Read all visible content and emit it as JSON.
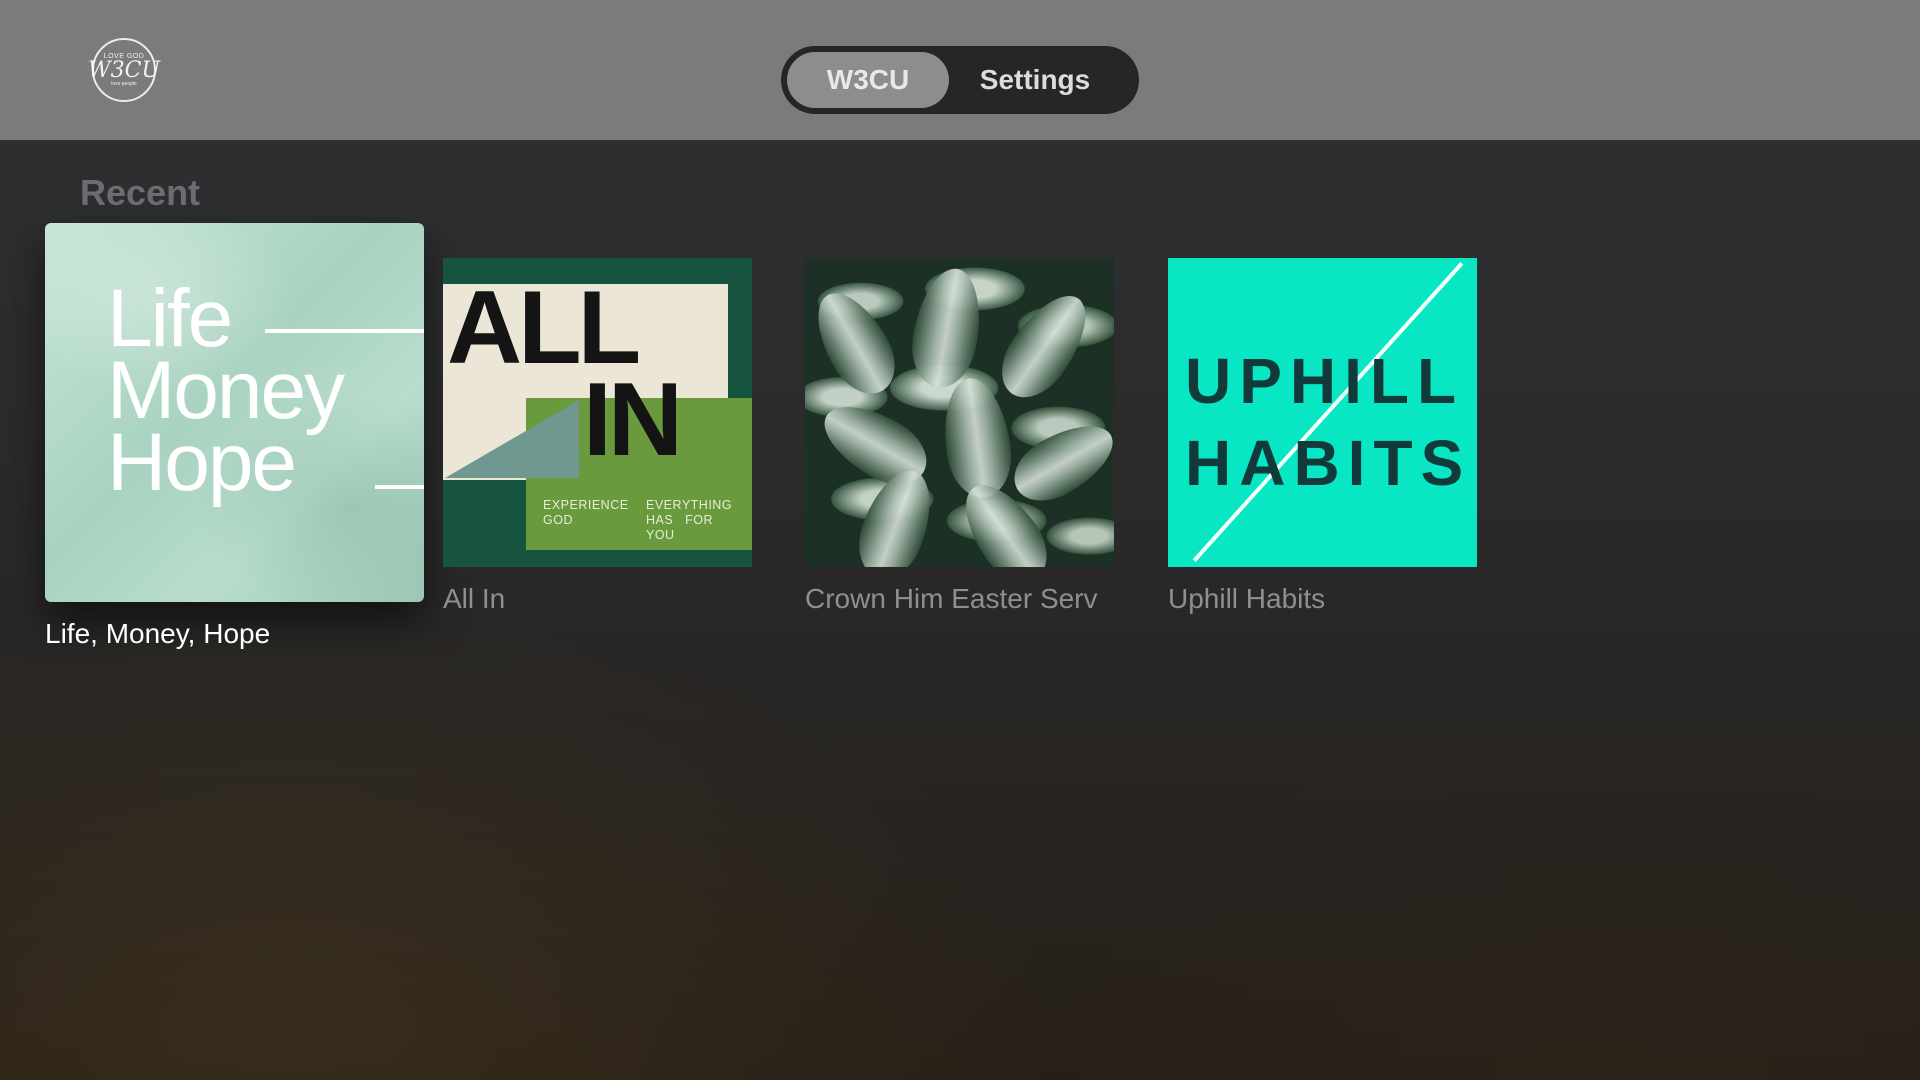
{
  "header": {
    "logo": {
      "icon": "w3cu-logo-icon",
      "line1": "LOVE GOD",
      "line2": "W3CU",
      "line3": "love people"
    },
    "tabs": [
      {
        "label": "W3CU",
        "selected": true
      },
      {
        "label": "Settings",
        "selected": false
      }
    ]
  },
  "section": {
    "title": "Recent",
    "items": [
      {
        "title": "Life, Money, Hope",
        "focused": true,
        "artwork": {
          "words": [
            "Life",
            "Money",
            "Hope"
          ]
        }
      },
      {
        "title": "All In",
        "focused": false,
        "artwork": {
          "line1": "ALL",
          "line2": "IN",
          "tagline": [
            "EXPERIENCE",
            "EVERYTHING",
            "GOD",
            "HAS",
            "FOR",
            "YOU"
          ]
        }
      },
      {
        "title": "Crown Him Easter Serv",
        "focused": false,
        "artwork": {
          "icon": "leaves-photo"
        }
      },
      {
        "title": "Uphill Habits",
        "focused": false,
        "artwork": {
          "line1": "UPHILL",
          "line2": "HABITS"
        }
      }
    ]
  },
  "colors": {
    "topbar": "#7b7b7b",
    "segmented_bg": "#262626",
    "segmented_active": "#8d8d8d",
    "section_title": "#6c6d70",
    "caption_focused": "#ffffff",
    "caption_unfocused": "#8e8f91",
    "uphill_bg": "#08e6c3"
  }
}
